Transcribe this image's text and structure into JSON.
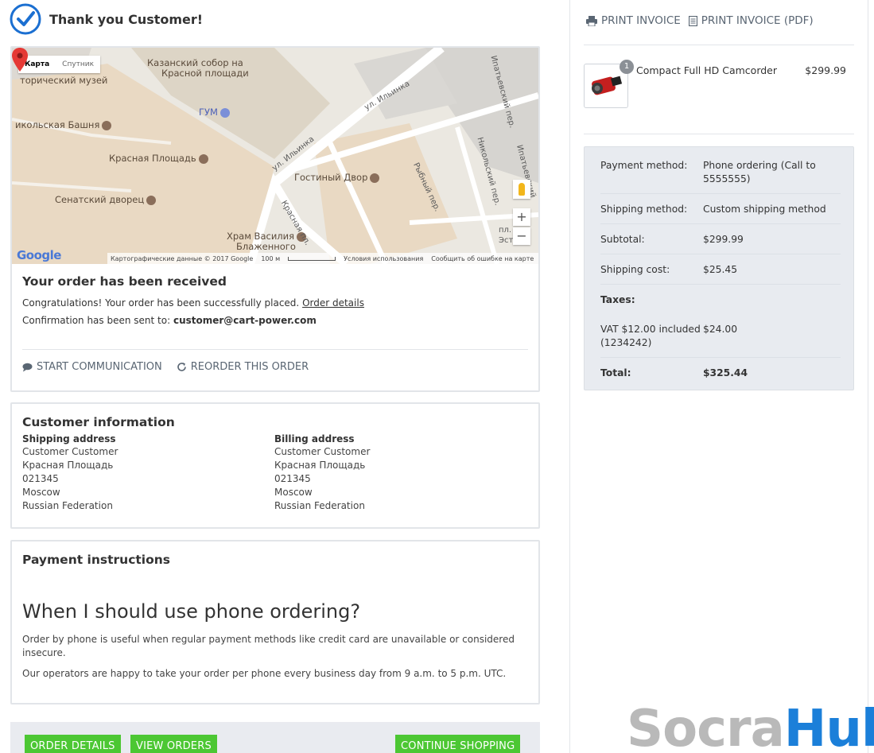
{
  "header": {
    "title": "Thank you Customer!"
  },
  "map": {
    "type_map": "Карта",
    "type_satellite": "Спутник",
    "labels": {
      "kazan1": "Казанский собор на",
      "kazan2": "Красной площади",
      "museum": "торический музей",
      "gum": "ГУМ",
      "tower": "икольская Башня",
      "ilyinka1": "ул. Ильинка",
      "ilyinka2": "ул. Ильинка",
      "square": "Красная Площадь",
      "gostiny": "Гостиный Двор",
      "senate": "Сенатский дворец",
      "vasily1": "Храм Василия",
      "vasily2": "Блаженного",
      "rybny": "Рыбный пер.",
      "nikolsky": "Никольский пер.",
      "ipatievsky": "Ипатьевский пер.",
      "krasnaya": "Красная пл.",
      "ipat2": "Ипатьевский",
      "pl": "пл.",
      "est": "Эст"
    },
    "zoom_in": "+",
    "zoom_out": "−",
    "google": "Google",
    "footer": {
      "data": "Картографические данные © 2017 Google",
      "scale": "100 м",
      "terms": "Условия использования",
      "report": "Сообщить об ошибке на карте"
    }
  },
  "order": {
    "title": "Your order has been received",
    "congrats": "Congratulations! Your order has been successfully placed.",
    "details_link": "Order details",
    "confirm_prefix": "Confirmation has been sent to:",
    "email": "customer@cart-power.com",
    "start_comm": "START COMMUNICATION",
    "reorder": "REORDER THIS ORDER"
  },
  "customer": {
    "title": "Customer information",
    "shipping": {
      "head": "Shipping address",
      "lines": [
        "Customer Customer",
        "Красная Площадь",
        "021345",
        "Moscow",
        "Russian Federation"
      ]
    },
    "billing": {
      "head": "Billing address",
      "lines": [
        "Customer Customer",
        "Красная Площадь",
        "021345",
        "Moscow",
        "Russian Federation"
      ]
    }
  },
  "payment": {
    "title": "Payment instructions",
    "heading": "When I should use phone ordering?",
    "p1": "Order by phone is useful when regular payment methods like credit card are unavailable or considered insecure.",
    "p2": "Our operators are happy to take your order per phone every business day from 9 a.m. to 5 p.m. UTC."
  },
  "buttons": {
    "order_details": "ORDER DETAILS",
    "view_orders": "VIEW ORDERS",
    "continue": "CONTINUE SHOPPING"
  },
  "invoice": {
    "print": "PRINT INVOICE",
    "print_pdf": "PRINT INVOICE (PDF)"
  },
  "product": {
    "qty": "1",
    "name": "Compact Full HD Camcorder",
    "price": "$299.99"
  },
  "summary": {
    "payment_k": "Payment method:",
    "payment_v": "Phone ordering (Call to 5555555)",
    "shipping_k": "Shipping method:",
    "shipping_v": "Custom shipping method",
    "subtotal_k": "Subtotal:",
    "subtotal_v": "$299.99",
    "shipcost_k": "Shipping cost:",
    "shipcost_v": "$25.45",
    "taxes_k": "Taxes:",
    "vat_k": "VAT $12.00 included (1234242)",
    "vat_v": "$24.00",
    "total_k": "Total:",
    "total_v": "$325.44"
  },
  "watermark": {
    "part1": "Socra",
    "part2": "Hub"
  },
  "colors": {
    "accent_blue": "#1b6fd1",
    "button_green": "#4cc733",
    "summary_bg": "#e8ebf0"
  }
}
